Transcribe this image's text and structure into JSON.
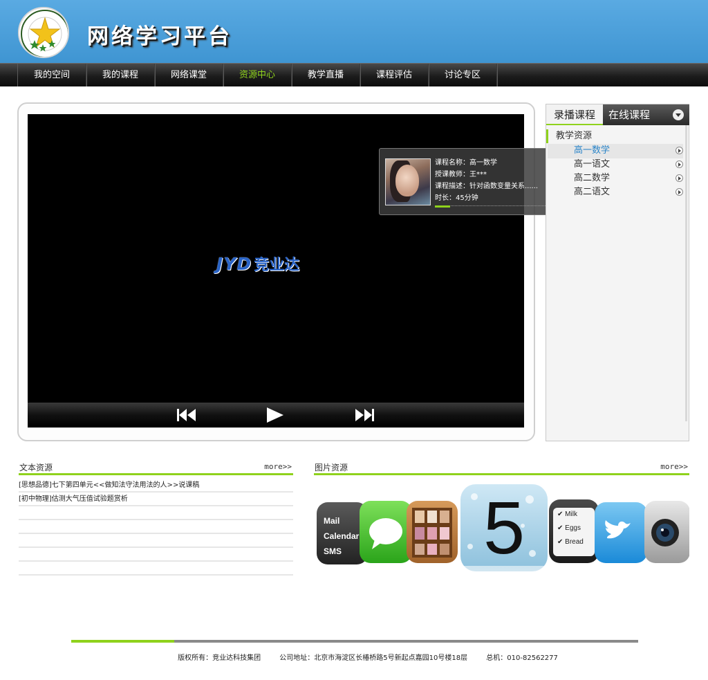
{
  "header": {
    "site_title": "网络学习平台",
    "logo_icon": "star-emblem-icon"
  },
  "nav": {
    "items": [
      {
        "label": "我的空间",
        "active": false
      },
      {
        "label": "我的课程",
        "active": false
      },
      {
        "label": "网络课堂",
        "active": false
      },
      {
        "label": "资源中心",
        "active": true
      },
      {
        "label": "教学直播",
        "active": false
      },
      {
        "label": "课程评估",
        "active": false
      },
      {
        "label": "讨论专区",
        "active": false
      }
    ]
  },
  "player": {
    "logo_latin": "JYD",
    "logo_cn": "竞业达",
    "controls": [
      "previous-icon",
      "play-icon",
      "next-icon"
    ]
  },
  "info": {
    "name_label": "课程名称：",
    "name": "高一数学",
    "teacher_label": "授课教师：",
    "teacher": "王***",
    "desc_label": "课程描述：",
    "desc": "针对函数变量关系......",
    "duration_label": "时长：",
    "duration": "45分钟"
  },
  "course_panel": {
    "tab_recorded": "录播课程",
    "tab_live": "在线课程",
    "category": "教学资源",
    "items": [
      "高一数学",
      "高一语文",
      "高二数学",
      "高二语文"
    ],
    "active_index": 0
  },
  "text_resources": {
    "title": "文本资源",
    "more": "more>>",
    "rows": [
      "[思想品德]七下第四单元<<做知法守法用法的人>>说课稿",
      "[初中物理]估测大气压值试验题赏析",
      "",
      "",
      "",
      "",
      ""
    ]
  },
  "image_resources": {
    "title": "图片资源",
    "more": "more>>",
    "icons": {
      "mail": {
        "line1": "Mail",
        "line2": "Calendar",
        "line3": "SMS"
      },
      "ios_number": "5",
      "reminders": {
        "line1": "Milk",
        "line2": "Eggs",
        "line3": "Bread"
      }
    }
  },
  "footer": {
    "copyright": "版权所有：竞业达科技集团",
    "address": "公司地址：北京市海淀区长椿桥路5号新起点嘉园10号楼18层",
    "phone": "总机：010-82562277"
  },
  "colors": {
    "header_blue": "#4a9fd9",
    "accent_green": "#8fd21c",
    "link_blue": "#2a84c8",
    "brand_blue": "#2a64c7"
  }
}
